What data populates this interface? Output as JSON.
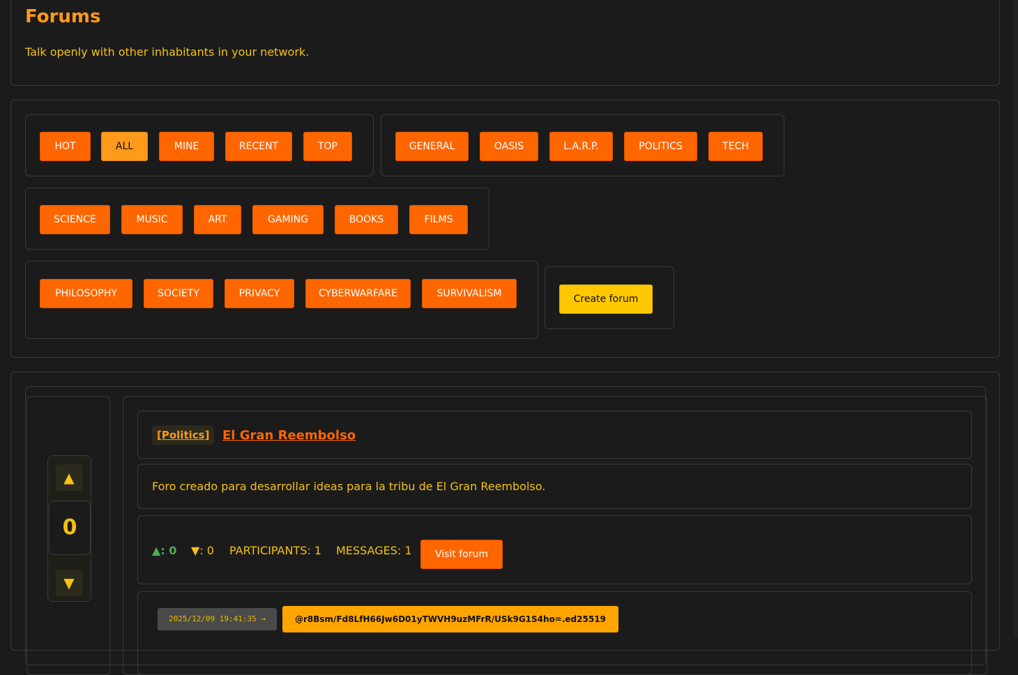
{
  "header": {
    "title": "Forums",
    "subtitle": "Talk openly with other inhabitants in your network."
  },
  "filters": {
    "sort": [
      "HOT",
      "ALL",
      "MINE",
      "RECENT",
      "TOP"
    ],
    "categories_1": [
      "GENERAL",
      "OASIS",
      "L.A.R.P.",
      "POLITICS",
      "TECH"
    ],
    "categories_2": [
      "SCIENCE",
      "MUSIC",
      "ART",
      "GAMING",
      "BOOKS",
      "FILMS"
    ],
    "categories_3": [
      "PHILOSOPHY",
      "SOCIETY",
      "PRIVACY",
      "CYBERWARFARE",
      "SURVIVALISM"
    ],
    "active": "ALL",
    "create_label": "Create forum"
  },
  "forum": {
    "category_tag": "[Politics]",
    "title": "El Gran Reembolso",
    "description": "Foro creado para desarrollar ideas para la tribu de El Gran Reembolso.",
    "vote_up_glyph": "▲",
    "vote_down_glyph": "▼",
    "score": "0",
    "upvotes_label": "▲: 0",
    "downvotes_label": "▼: 0",
    "participants_label": "PARTICIPANTS: 1",
    "messages_label": "MESSAGES: 1",
    "visit_label": "Visit forum",
    "timestamp": "2025/12/09 19:41:35 →",
    "author": "@r8Bsm/Fd8LfH66Jw6D01yTWVH9uzMFrR/USk9G1S4ho=.ed25519"
  },
  "colors": {
    "background": "#1b1b1b",
    "accent_orange": "#ff6600",
    "active_orange": "#ff9a1a",
    "text_yellow": "#f5c211",
    "create_yellow": "#ffc800",
    "upvote_green": "#4caf50"
  }
}
